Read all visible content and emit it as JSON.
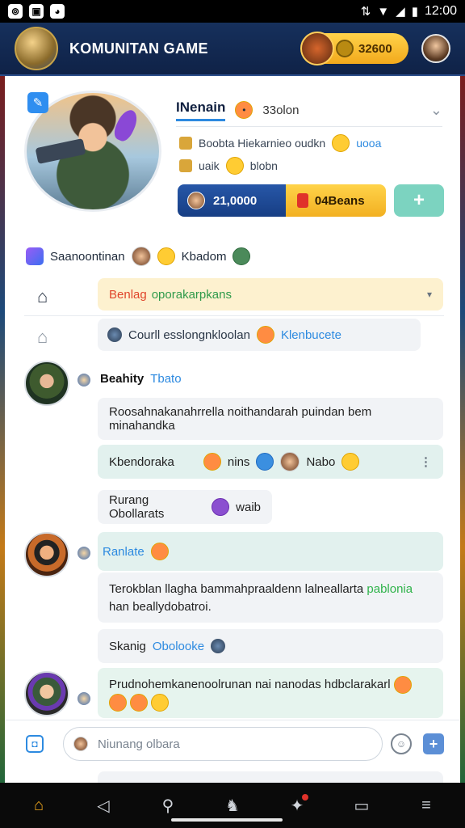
{
  "status_bar": {
    "time": "12:00"
  },
  "header": {
    "title": "KOMUNITAN GAME",
    "coins": "32600"
  },
  "profile": {
    "name": "INenain",
    "status": "33olon",
    "info_line1": "Boobta Hiekarnieo oudkn",
    "info_line1_accent": "uooa",
    "info_line2": "uaik",
    "info_line2_b": "blobn",
    "stat_value": "21,0000",
    "stat_tickets": "04Beans"
  },
  "friends": {
    "label": "Saanoontinan",
    "label2": "Kbadom"
  },
  "nav": {
    "item1_part1": "Benlag",
    "item1_part2": "oporakarpkans",
    "item2_text": "Courll esslongnkloolan",
    "item2_accent": "Klenbucete"
  },
  "chat": {
    "msg1_sender": "Beahity",
    "msg1_tag": "Tbato",
    "msg1_text": "Roosahnakanahrrella noithandarah puindan bem minahandka",
    "msg2_text": "Kbendoraka",
    "msg2_text2": "nins",
    "msg2_text3": "Nabo",
    "msg3_text": "Rurang Obollarats",
    "msg3_text2": "waib",
    "msg4_sender": "Ranlate",
    "msg4_line1": "Terokblan llagha bammahpraaldenn lalneallarta",
    "msg4_line1_green": "pablonia",
    "msg4_line2": "han beallydobatroi.",
    "msg5_text": "Skanig",
    "msg5_accent": "Obolooke",
    "msg6_text": "Prudnohemkanenoolrunan nai nanodas hdbclarakarl"
  },
  "composer": {
    "placeholder": "Niunang olbara"
  },
  "icons": {
    "status": [
      "notification-icon",
      "gallery-icon",
      "cat-icon",
      "wifi-icon",
      "signal-icon",
      "battery-icon"
    ],
    "bottom_nav": [
      "home-icon",
      "back-icon",
      "search-icon",
      "game-icon",
      "ping-pong-icon",
      "inbox-icon",
      "menu-icon"
    ]
  },
  "colors": {
    "header_bg": "#16305c",
    "accent_blue": "#2d8ae0",
    "gold": "#f2a91c",
    "mint": "#7cd3c0"
  }
}
